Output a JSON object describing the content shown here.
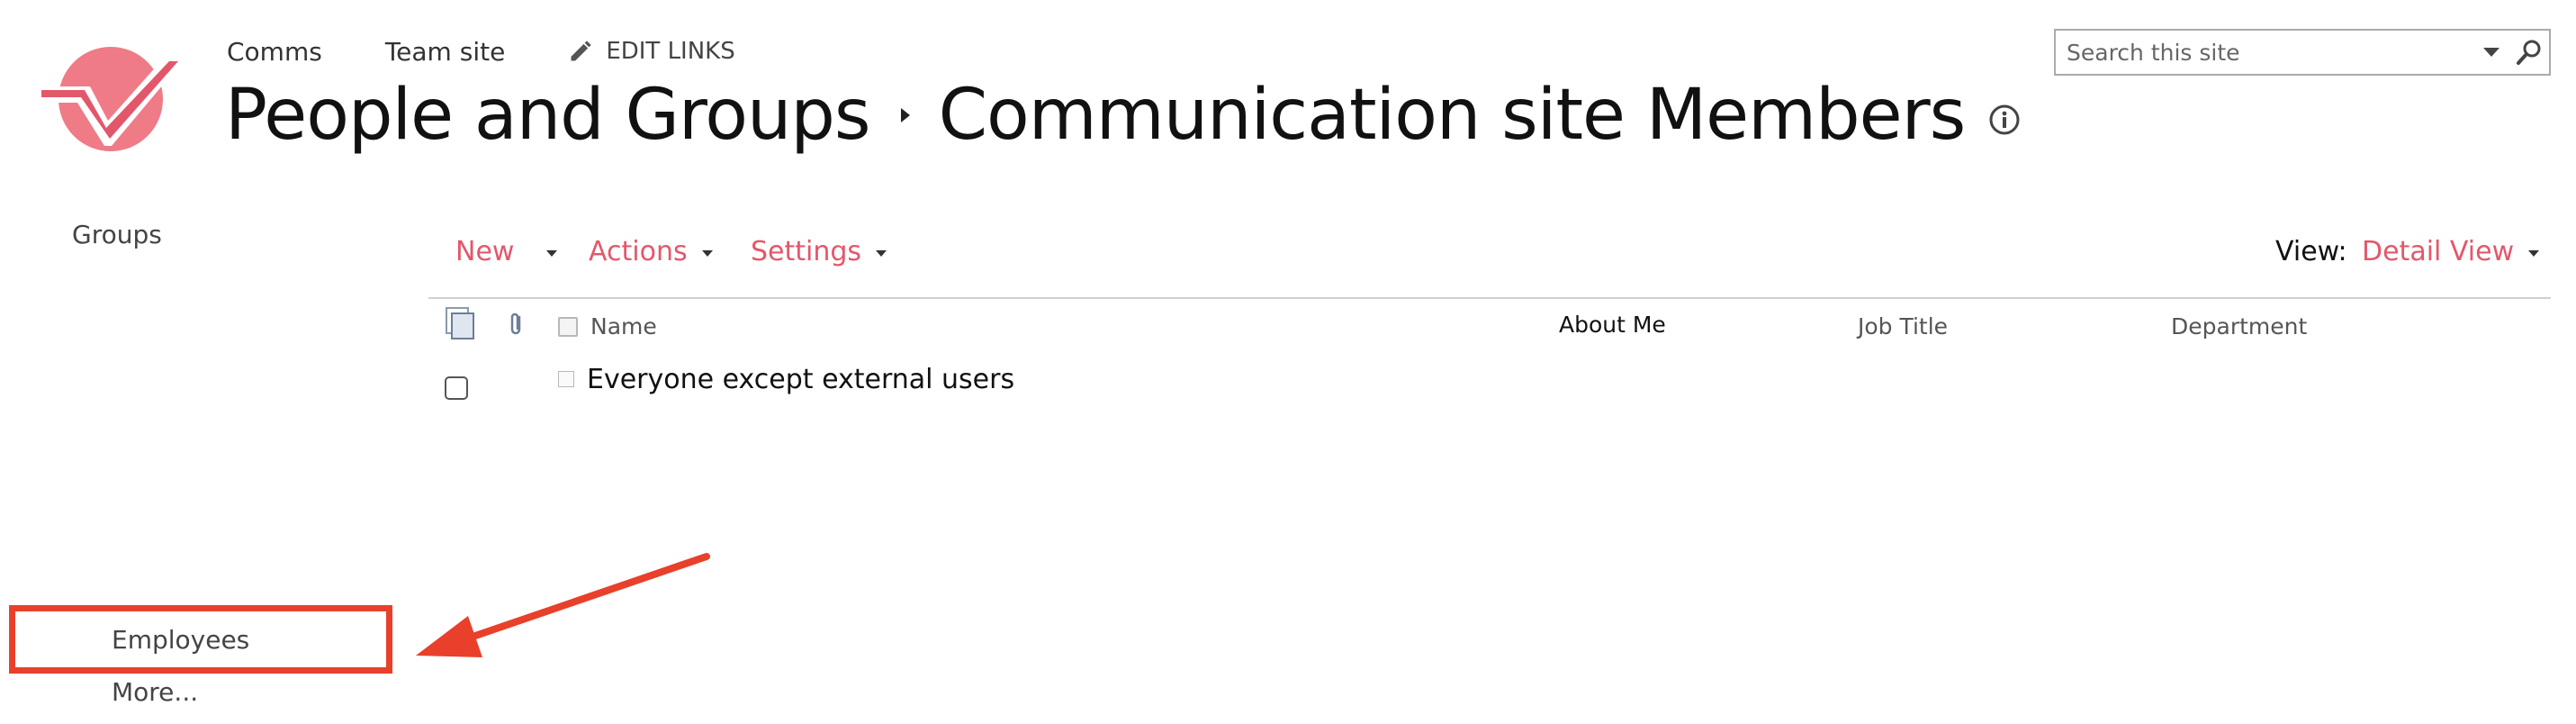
{
  "top_nav": {
    "links": [
      "Comms",
      "Team site"
    ],
    "edit_links_label": "EDIT LINKS"
  },
  "title": {
    "parent": "People and Groups",
    "current": "Communication site Members"
  },
  "search": {
    "placeholder": "Search this site"
  },
  "left_nav": {
    "heading": "Groups",
    "items": [
      "Employees",
      "More..."
    ]
  },
  "toolbar": {
    "new_label": "New",
    "actions_label": "Actions",
    "settings_label": "Settings",
    "view_label": "View:",
    "view_value": "Detail View"
  },
  "table": {
    "columns": [
      "Name",
      "About Me",
      "Job Title",
      "Department"
    ],
    "rows": [
      {
        "name": "Everyone except external users"
      }
    ]
  },
  "icons": [
    "logo-icon",
    "pencil-icon",
    "chevron-right-icon",
    "info-icon",
    "dropdown-icon",
    "search-icon",
    "documents-icon",
    "paperclip-icon"
  ],
  "colors": {
    "accent": "#e3576b",
    "annotation": "#e8402a"
  }
}
